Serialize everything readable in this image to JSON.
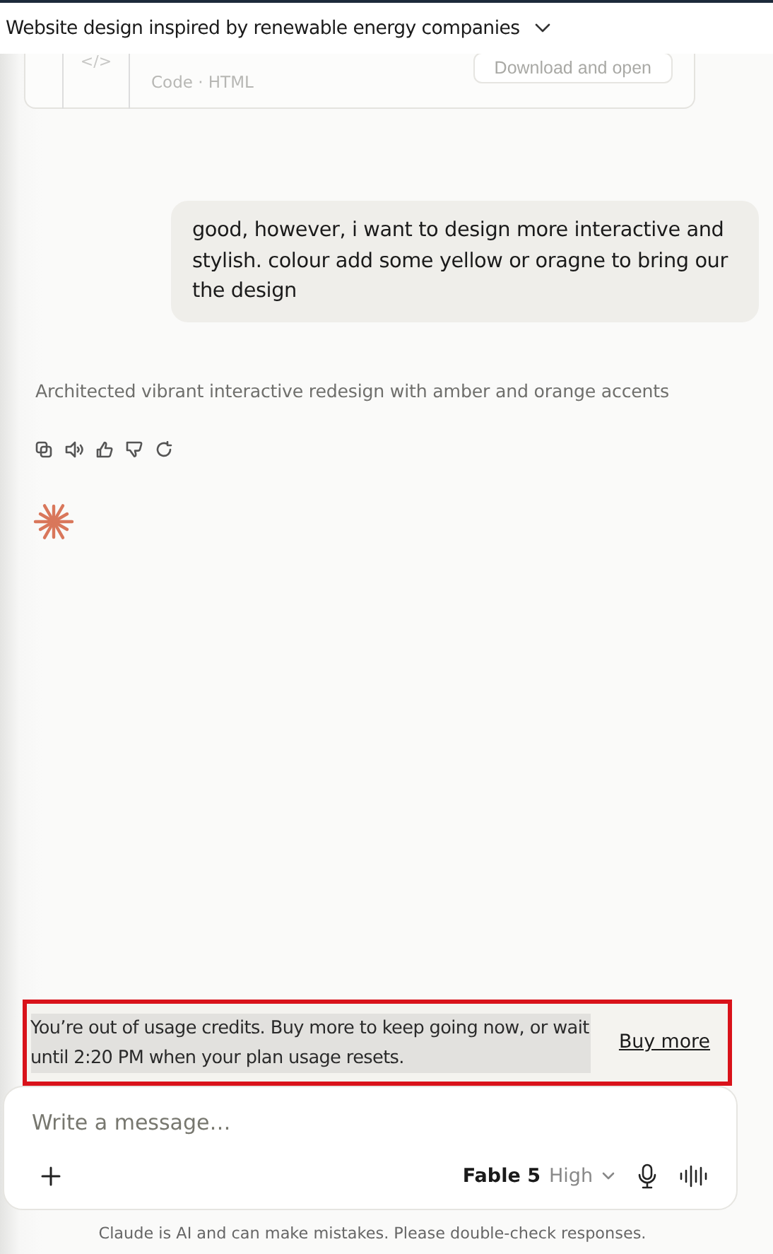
{
  "header": {
    "title": "Website design inspired by renewable energy companies"
  },
  "artifact": {
    "icon": "</>",
    "meta": "Code · HTML",
    "button": "Download and open"
  },
  "messages": [
    {
      "kind": "user",
      "text": "good, however, i want to design more interactive and stylish. colour add some yellow or oragne to bring our the design"
    },
    {
      "kind": "thinking",
      "text": "Architected vibrant interactive redesign with amber and orange accents"
    }
  ],
  "banner": {
    "text": "You’re out of usage credits. Buy more to keep going now, or wait until 2:20 PM when your plan usage resets.",
    "text_selected": true,
    "link": "Buy more"
  },
  "composer": {
    "placeholder": "Write a message…",
    "model": "Fable 5",
    "effort": "High"
  },
  "footer": "Claude is AI and can make mistakes. Please double-check responses."
}
